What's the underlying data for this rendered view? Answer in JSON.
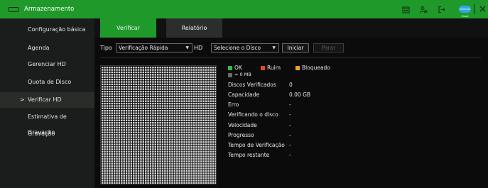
{
  "window": {
    "title": "Armazenamento"
  },
  "titlebar_icons": [
    "calendar-icon",
    "user-settings-icon",
    "logout-icon",
    "cloud-icon",
    "close-icon"
  ],
  "titlebar": {
    "cloud_badge": "Intelbras Cloud"
  },
  "sidebar": {
    "items": [
      {
        "label": "Configuração básica"
      },
      {
        "label": "Agenda"
      },
      {
        "label": "Gerenciar HD"
      },
      {
        "label": "Quota de Disco"
      },
      {
        "label": "Verificar HD",
        "active": true,
        "chevron": ">"
      },
      {
        "label": "Estimativa de Gravação"
      },
      {
        "label": "Gravação"
      }
    ]
  },
  "tabs": [
    {
      "label": "Verificar",
      "active": true
    },
    {
      "label": "Relatório",
      "active": false
    }
  ],
  "filter": {
    "tipo_label": "Tipo",
    "tipo_value": "Verificação Rápida",
    "hd_label": "HD",
    "hd_value": "Selecione o Disco",
    "start_label": "Iniciar",
    "stop_label": "Parar"
  },
  "legend": {
    "ok": "OK",
    "bad": "Ruim",
    "blocked": "Bloqueado",
    "unit": "= 0 MB",
    "colors": {
      "ok": "#2fbf3a",
      "bad": "#e8472a",
      "blocked": "#f0a020",
      "unit": "#6a6a6a"
    }
  },
  "info": [
    {
      "label": "Discos Verificados",
      "value": "0"
    },
    {
      "label": "Capacidade",
      "value": "0.00 GB"
    },
    {
      "label": "Erro",
      "value": "-"
    },
    {
      "label": "Verificando o disco",
      "value": "-"
    },
    {
      "label": "Velocidade",
      "value": "-"
    },
    {
      "label": "Progresso",
      "value": "-"
    },
    {
      "label": "Tempo de Verificação",
      "value": "-"
    },
    {
      "label": "Tempo restante",
      "value": "-"
    }
  ],
  "colors": {
    "accent": "#1f9a2a",
    "background": "#0b0b0b",
    "sidebar": "#1a1d1b"
  }
}
